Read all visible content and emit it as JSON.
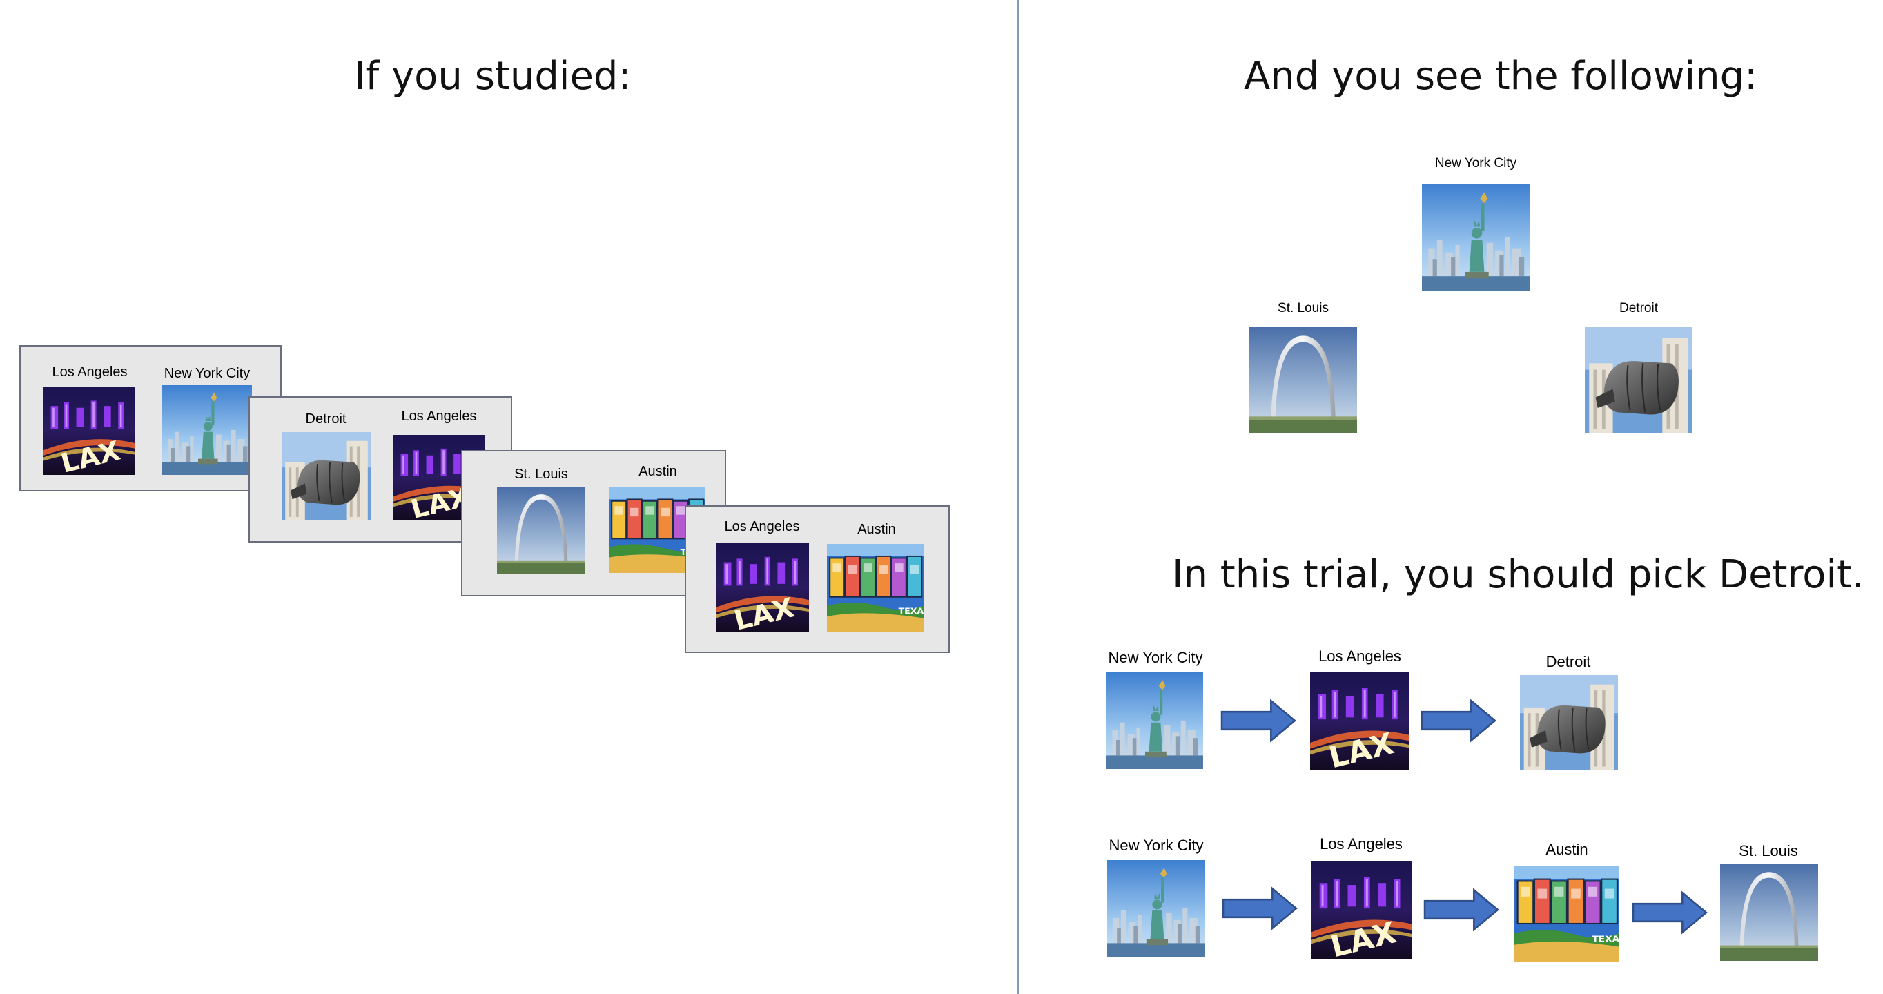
{
  "left": {
    "heading": "If you studied:",
    "cards": [
      {
        "left_label": "Los Angeles",
        "right_label": "New York City"
      },
      {
        "left_label": "Detroit",
        "right_label": "Los Angeles"
      },
      {
        "left_label": "St. Louis",
        "right_label": "Austin"
      },
      {
        "left_label": "Los Angeles",
        "right_label": "Austin"
      }
    ]
  },
  "right": {
    "heading": "And you see the following:",
    "choices": {
      "top": "New York City",
      "left": "St. Louis",
      "right": "Detroit"
    },
    "instruction": "In this trial, you should pick Detroit.",
    "chain1": [
      "New York City",
      "Los Angeles",
      "Detroit"
    ],
    "chain2": [
      "New York City",
      "Los Angeles",
      "Austin",
      "St. Louis"
    ]
  },
  "image_names": {
    "nyc": "statue-of-liberty-image",
    "la": "lax-sign-image",
    "detroit": "fist-monument-image",
    "stlouis": "gateway-arch-image",
    "austin": "austin-postcard-image"
  },
  "colors": {
    "arrow_fill": "#4472c4",
    "arrow_stroke": "#2f4f8a",
    "divider": "#7f9bb5",
    "card_bg": "#e7e7e7"
  }
}
